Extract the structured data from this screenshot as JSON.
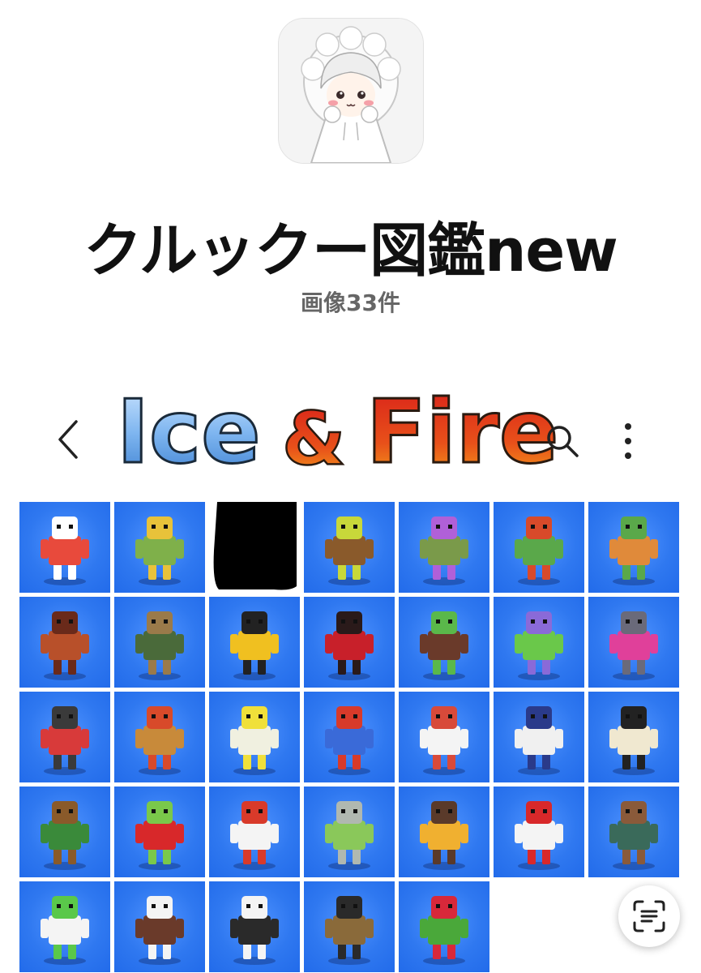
{
  "album": {
    "title": "クルックー図鑑new",
    "count_label": "画像33件"
  },
  "header": {
    "logo_text_ice": "Ice",
    "logo_text_amp": "&",
    "logo_text_fire": "Fire"
  },
  "icons": {
    "back": "chevron-left-icon",
    "search": "search-icon",
    "more": "more-vertical-icon",
    "scan": "scan-text-icon"
  },
  "colors": {
    "tile_blue": "#2f78f0",
    "title": "#111111",
    "subtitle": "#666666"
  },
  "thumbnails": [
    {
      "id": "t01",
      "kind": "clown-figure",
      "main": "#e84a3c",
      "accent": "#ffffff",
      "redacted": false
    },
    {
      "id": "t02",
      "kind": "crowned-robot",
      "main": "#7fb04a",
      "accent": "#e8c23a",
      "redacted": false
    },
    {
      "id": "t03",
      "kind": "hidden",
      "main": "#000000",
      "accent": "#000000",
      "redacted": true
    },
    {
      "id": "t04",
      "kind": "deer",
      "main": "#8a5a2b",
      "accent": "#c8d83a",
      "redacted": false
    },
    {
      "id": "t05",
      "kind": "fairy",
      "main": "#7a9a4a",
      "accent": "#b060d8",
      "redacted": false
    },
    {
      "id": "t06",
      "kind": "mushroom-man",
      "main": "#5aa84a",
      "accent": "#d84a2a",
      "redacted": false
    },
    {
      "id": "t07",
      "kind": "fox-warrior",
      "main": "#e08a3a",
      "accent": "#5aa84a",
      "redacted": false
    },
    {
      "id": "t08",
      "kind": "brick-block",
      "main": "#b8502a",
      "accent": "#6a2a1a",
      "redacted": false
    },
    {
      "id": "t09",
      "kind": "soldier",
      "main": "#4a6a3a",
      "accent": "#9a7a4a",
      "redacted": false
    },
    {
      "id": "t10",
      "kind": "excavator-mech",
      "main": "#f0c020",
      "accent": "#222222",
      "redacted": false
    },
    {
      "id": "t11",
      "kind": "lava-dog",
      "main": "#c8202a",
      "accent": "#2a1a1a",
      "redacted": false
    },
    {
      "id": "t12",
      "kind": "banana-brawler",
      "main": "#6a3a2a",
      "accent": "#5ab84a",
      "redacted": false
    },
    {
      "id": "t13",
      "kind": "green-robot",
      "main": "#6ac84a",
      "accent": "#8a6ad8",
      "redacted": false
    },
    {
      "id": "t14",
      "kind": "pink-mech",
      "main": "#e0409a",
      "accent": "#6a6a7a",
      "redacted": false
    },
    {
      "id": "t15",
      "kind": "spider-clown",
      "main": "#d83a3a",
      "accent": "#3a3a3a",
      "redacted": false
    },
    {
      "id": "t16",
      "kind": "straw-hut-golem",
      "main": "#c88a3a",
      "accent": "#d84a2a",
      "redacted": false
    },
    {
      "id": "t17",
      "kind": "plug-and-bulb",
      "main": "#f0f0e0",
      "accent": "#f0e03a",
      "redacted": false
    },
    {
      "id": "t18",
      "kind": "king",
      "main": "#3a6ad8",
      "accent": "#d83a2a",
      "redacted": false
    },
    {
      "id": "t19",
      "kind": "snow-boat",
      "main": "#f4f4f4",
      "accent": "#d84a3a",
      "redacted": false
    },
    {
      "id": "t20",
      "kind": "satellite-bird",
      "main": "#f0f0f0",
      "accent": "#2a3a8a",
      "redacted": false
    },
    {
      "id": "t21",
      "kind": "skeleton",
      "main": "#f0e8d0",
      "accent": "#222222",
      "redacted": false
    },
    {
      "id": "t22",
      "kind": "cactus-cowboy",
      "main": "#3a8a3a",
      "accent": "#8a5a2a",
      "redacted": false
    },
    {
      "id": "t23",
      "kind": "red-bird-hula",
      "main": "#d8282a",
      "accent": "#7ac84a",
      "redacted": false
    },
    {
      "id": "t24",
      "kind": "rocket",
      "main": "#f4f4f4",
      "accent": "#d83a2a",
      "redacted": false
    },
    {
      "id": "t25",
      "kind": "rhino-helicopter",
      "main": "#8ac85a",
      "accent": "#b0b8b0",
      "redacted": false
    },
    {
      "id": "t26",
      "kind": "buffalo-sun",
      "main": "#f0b030",
      "accent": "#5a3a2a",
      "redacted": false
    },
    {
      "id": "t27",
      "kind": "soccer-ball",
      "main": "#f4f4f4",
      "accent": "#d8282a",
      "redacted": false
    },
    {
      "id": "t28",
      "kind": "shovel",
      "main": "#3a6a5a",
      "accent": "#8a5a3a",
      "redacted": false
    },
    {
      "id": "t29",
      "kind": "cow-trio",
      "main": "#f4f4f4",
      "accent": "#5ac84a",
      "redacted": false
    },
    {
      "id": "t30",
      "kind": "piano-bear",
      "main": "#6a3a2a",
      "accent": "#f4f4f4",
      "redacted": false
    },
    {
      "id": "t31",
      "kind": "penguin-trio",
      "main": "#2a2a2a",
      "accent": "#f4f4f4",
      "redacted": false
    },
    {
      "id": "t32",
      "kind": "bear-duo",
      "main": "#8a6a3a",
      "accent": "#2a2a2a",
      "redacted": false
    },
    {
      "id": "t33",
      "kind": "watermelon",
      "main": "#4aa83a",
      "accent": "#d8283a",
      "redacted": false
    }
  ]
}
